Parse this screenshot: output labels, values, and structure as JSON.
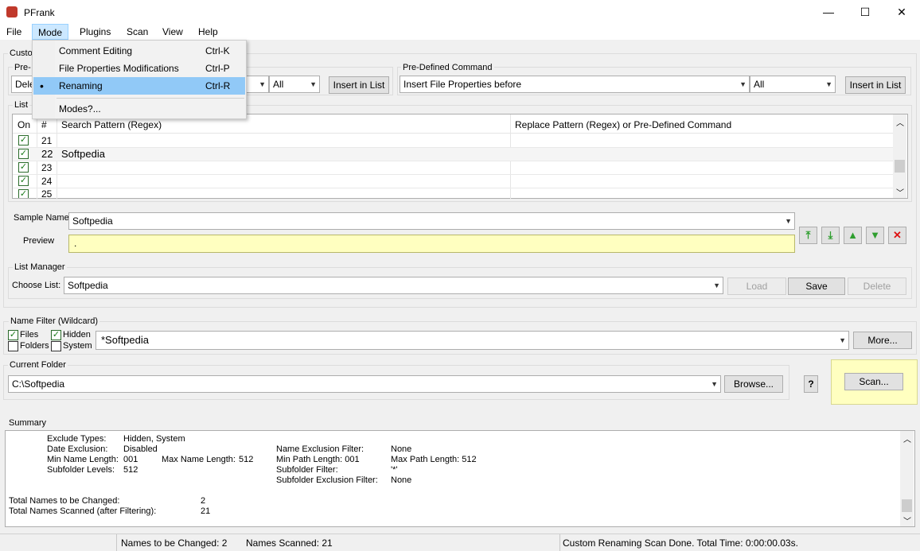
{
  "window": {
    "title": "PFrank",
    "minimize": "—",
    "maximize": "☐",
    "close": "✕"
  },
  "menu": {
    "file": "File",
    "mode": "Mode",
    "plugins": "Plugins",
    "scan": "Scan",
    "view": "View",
    "help": "Help"
  },
  "mode_menu": {
    "items": [
      {
        "label": "Comment Editing",
        "shortcut": "Ctrl-K"
      },
      {
        "label": "File Properties Modifications",
        "shortcut": "Ctrl-P"
      },
      {
        "label": "Renaming",
        "shortcut": "Ctrl-R",
        "selected": true
      },
      {
        "label": "Modes?...",
        "shortcut": ""
      }
    ]
  },
  "custom_group": {
    "label": "Custo",
    "predef_left_label": "Pre-",
    "left_combo": "Dele",
    "all_left": "All",
    "insert_left": "Insert in List"
  },
  "predefined_command": {
    "label": "Pre-Defined Command",
    "combo": "Insert File Properties before",
    "all": "All",
    "insert": "Insert in List"
  },
  "list": {
    "label": "List",
    "headers": {
      "on": "On",
      "num": "#",
      "search": "Search Pattern (Regex)",
      "replace": "Replace Pattern (Regex)  or  Pre-Defined Command"
    },
    "rows": [
      {
        "num": "21",
        "search": "",
        "replace": ""
      },
      {
        "num": "22",
        "search": "Softpedia",
        "replace": ""
      },
      {
        "num": "23",
        "search": "",
        "replace": ""
      },
      {
        "num": "24",
        "search": "",
        "replace": ""
      },
      {
        "num": "25",
        "search": "",
        "replace": ""
      }
    ]
  },
  "sample": {
    "label": "Sample Name",
    "value": "Softpedia"
  },
  "preview": {
    "label": "Preview",
    "value": "."
  },
  "list_manager": {
    "label": "List Manager",
    "choose_label": "Choose List:",
    "value": "Softpedia",
    "load": "Load",
    "save": "Save",
    "delete": "Delete"
  },
  "name_filter": {
    "label": "Name Filter (Wildcard)",
    "files": "Files",
    "hidden": "Hidden",
    "folders": "Folders",
    "system": "System",
    "value": "*Softpedia",
    "more": "More..."
  },
  "current_folder": {
    "label": "Current Folder",
    "value": "C:\\Softpedia",
    "browse": "Browse...",
    "help": "?"
  },
  "scan_button": "Scan...",
  "summary": {
    "label": "Summary",
    "exclude_types_k": "Exclude Types:",
    "exclude_types_v": "Hidden, System",
    "date_excl_k": "Date Exclusion:",
    "date_excl_v": "Disabled",
    "min_name_k": "Min Name Length:",
    "min_name_v": "001",
    "max_name_k": "Max Name Length:",
    "max_name_v": "512",
    "sub_levels_k": "Subfolder Levels:",
    "sub_levels_v": "512",
    "name_excl_k": "Name Exclusion Filter:",
    "name_excl_v": "None",
    "min_path_k": "Min Path Length: 001",
    "max_path_k": "Max Path Length: 512",
    "sub_filter_k": "Subfolder Filter:",
    "sub_filter_v": "'*'",
    "sub_excl_k": "Subfolder Exclusion Filter:",
    "sub_excl_v": "None",
    "total_changed_k": "Total Names to be Changed:",
    "total_changed_v": "2",
    "total_scanned_k": "Total Names Scanned (after Filtering):",
    "total_scanned_v": "21"
  },
  "status": {
    "changed": "Names to be Changed: 2",
    "scanned": "Names Scanned: 21",
    "message": "Custom Renaming Scan Done.  Total Time: 0:00:00.03s."
  }
}
